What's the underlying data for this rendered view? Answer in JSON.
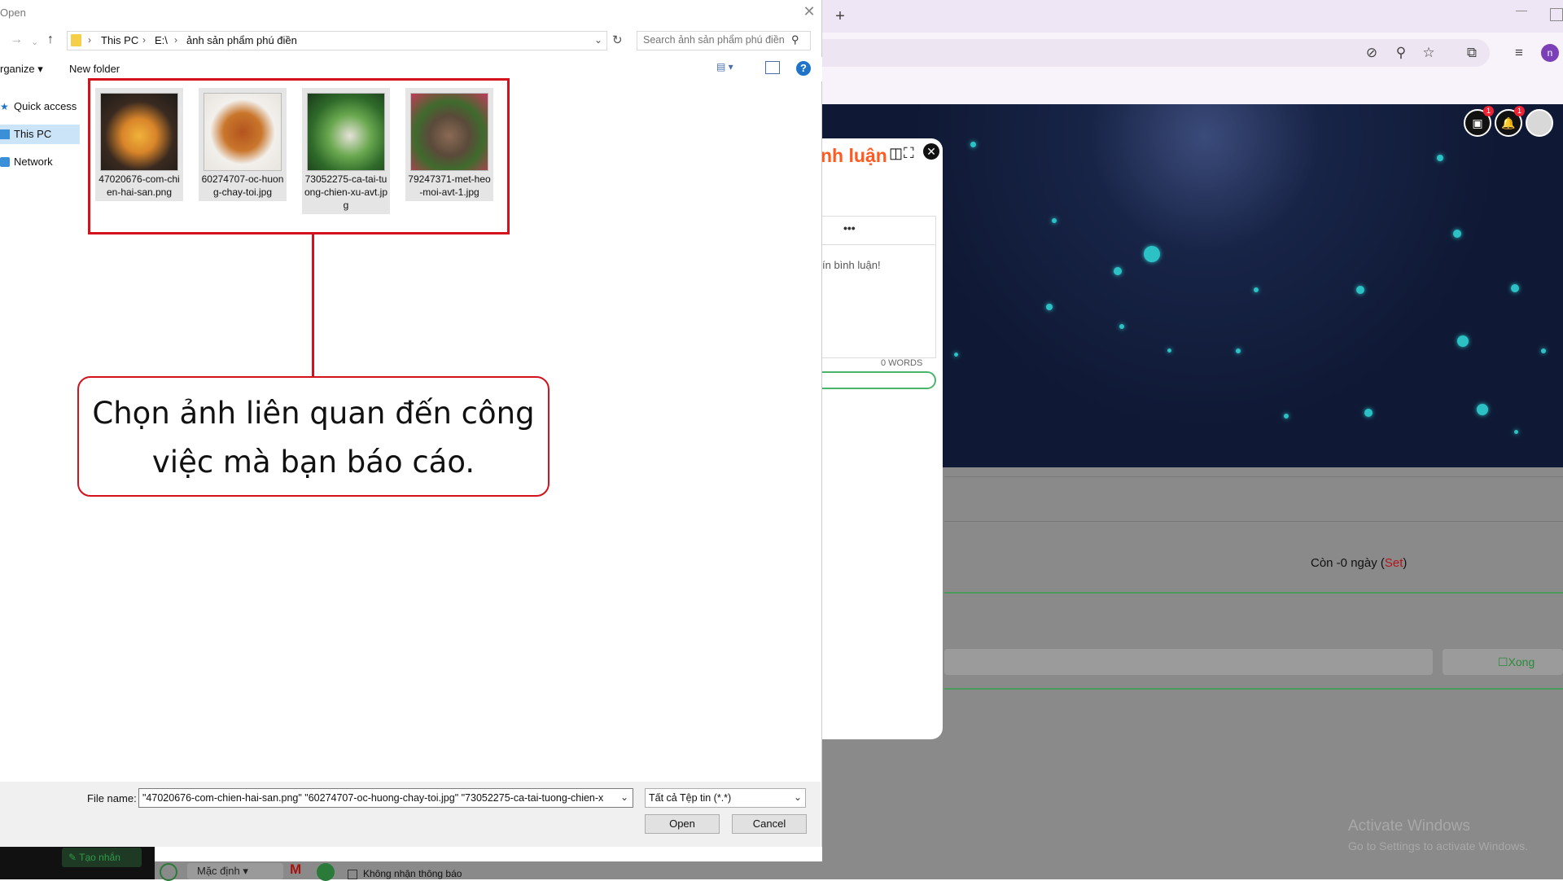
{
  "browser": {
    "new_tab": "+",
    "minimize": "—",
    "avatar_letter": "n",
    "icons": [
      "eye-off-icon",
      "zoom-icon",
      "star-icon",
      "extensions-icon",
      "media-icon",
      "profile-icon"
    ],
    "notification_count": "1",
    "alert_count": "1"
  },
  "comment_modal": {
    "title": "nh luận",
    "more": "•••",
    "placeholder": "ín bình luận!",
    "word_count": "0 WORDS"
  },
  "page": {
    "countdown_prefix": "Còn -0 ngày (",
    "countdown_set": "Set",
    "countdown_suffix": ")",
    "done_label": "Xong",
    "create_label": "Tạo nhắn",
    "select_value": "Mặc định",
    "mute_label": "Không nhận thông báo"
  },
  "watermark": {
    "title": "Activate Windows",
    "subtitle": "Go to Settings to activate Windows."
  },
  "dialog": {
    "title": "Open",
    "close": "✕",
    "breadcrumbs": [
      "This PC",
      "E:\\",
      "ảnh sản phẩm phú điền"
    ],
    "search_placeholder": "Search ảnh sản phẩm phú điền",
    "organize": "rganize",
    "new_folder": "New folder",
    "help": "?",
    "nav": [
      "Quick access",
      "This PC",
      "Network"
    ],
    "files": [
      {
        "name": "47020676-com-chien-hai-san.png"
      },
      {
        "name": "60274707-oc-huong-chay-toi.jpg"
      },
      {
        "name": "73052275-ca-tai-tuong-chien-xu-avt.jpg"
      },
      {
        "name": "79247371-met-heo-moi-avt-1.jpg"
      }
    ],
    "file_name_label": "File name:",
    "file_name_value": "\"47020676-com-chien-hai-san.png\" \"60274707-oc-huong-chay-toi.jpg\" \"73052275-ca-tai-tuong-chien-x",
    "file_type": "Tất cả Tệp tin (*.*)",
    "open_label": "Open",
    "cancel_label": "Cancel"
  },
  "annotation": {
    "text_line1": "Chọn ảnh liên quan đến công",
    "text_line2": "việc mà bạn báo cáo."
  },
  "colors": {
    "highlight": "#d4121c",
    "accent_orange": "#ff5a1f",
    "nav_selected": "#cce4f7"
  }
}
